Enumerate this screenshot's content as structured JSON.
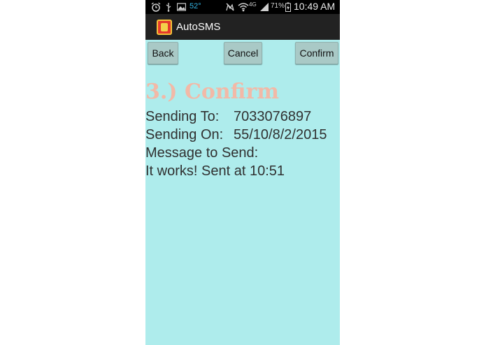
{
  "status_bar": {
    "temperature": "52°",
    "network": "4G",
    "battery": "71%",
    "time": "10:49 AM"
  },
  "action_bar": {
    "app_title": "AutoSMS"
  },
  "buttons": {
    "back": "Back",
    "cancel": "Cancel",
    "confirm": "Confirm"
  },
  "content": {
    "heading": "3.) Confirm",
    "sending_to_label": "Sending To:",
    "sending_to_value": "7033076897",
    "sending_on_label": "Sending On:",
    "sending_on_value": "55/10/8/2/2015",
    "message_label": "Message to Send:",
    "message_text": "It works!  Sent at 10:51"
  },
  "colors": {
    "background": "#aeecec",
    "heading": "#f2b9a7",
    "action_bar": "#222222",
    "button": "#a9c9c6"
  },
  "icons": [
    "alarm-icon",
    "usb-icon",
    "image-icon",
    "mute-icon",
    "wifi-icon",
    "signal-icon",
    "battery-icon",
    "app-logo-icon"
  ]
}
